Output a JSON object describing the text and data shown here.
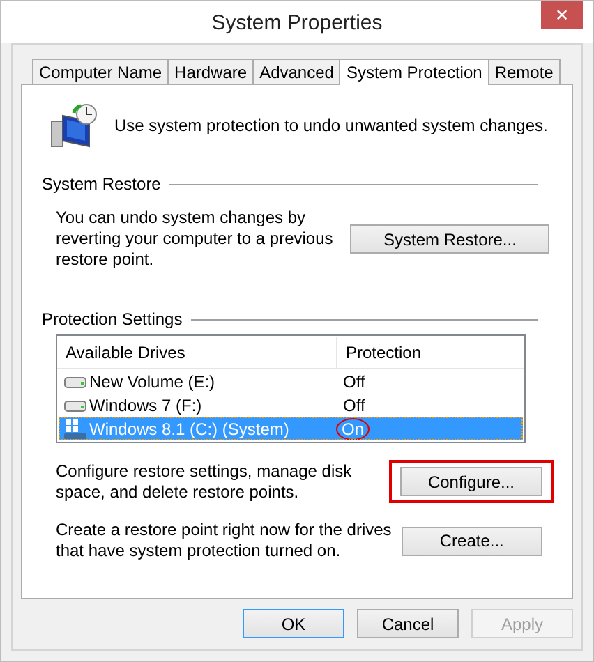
{
  "window": {
    "title": "System Properties",
    "close": "✕"
  },
  "tabs": [
    {
      "label": "Computer Name",
      "selected": false
    },
    {
      "label": "Hardware",
      "selected": false
    },
    {
      "label": "Advanced",
      "selected": false
    },
    {
      "label": "System Protection",
      "selected": true
    },
    {
      "label": "Remote",
      "selected": false
    }
  ],
  "intro": "Use system protection to undo unwanted system changes.",
  "system_restore": {
    "heading": "System Restore",
    "text": "You can undo system changes by reverting your computer to a previous restore point.",
    "button": "System Restore..."
  },
  "protection_settings": {
    "heading": "Protection Settings",
    "columns": [
      "Available Drives",
      "Protection"
    ],
    "rows": [
      {
        "drive": "New Volume (E:)",
        "protection": "Off",
        "kind": "disk",
        "selected": false,
        "highlighted": false
      },
      {
        "drive": "Windows 7 (F:)",
        "protection": "Off",
        "kind": "disk",
        "selected": false,
        "highlighted": false
      },
      {
        "drive": "Windows 8.1 (C:) (System)",
        "protection": "On",
        "kind": "system",
        "selected": true,
        "highlighted": true
      }
    ],
    "configure": {
      "text": "Configure restore settings, manage disk space, and delete restore points.",
      "button": "Configure...",
      "highlighted": true
    },
    "create": {
      "text": "Create a restore point right now for the drives that have system protection turned on.",
      "button": "Create..."
    }
  },
  "buttons": [
    {
      "label": "OK",
      "kind": "default",
      "disabled": false
    },
    {
      "label": "Cancel",
      "kind": "normal",
      "disabled": false
    },
    {
      "label": "Apply",
      "kind": "normal",
      "disabled": true
    }
  ]
}
